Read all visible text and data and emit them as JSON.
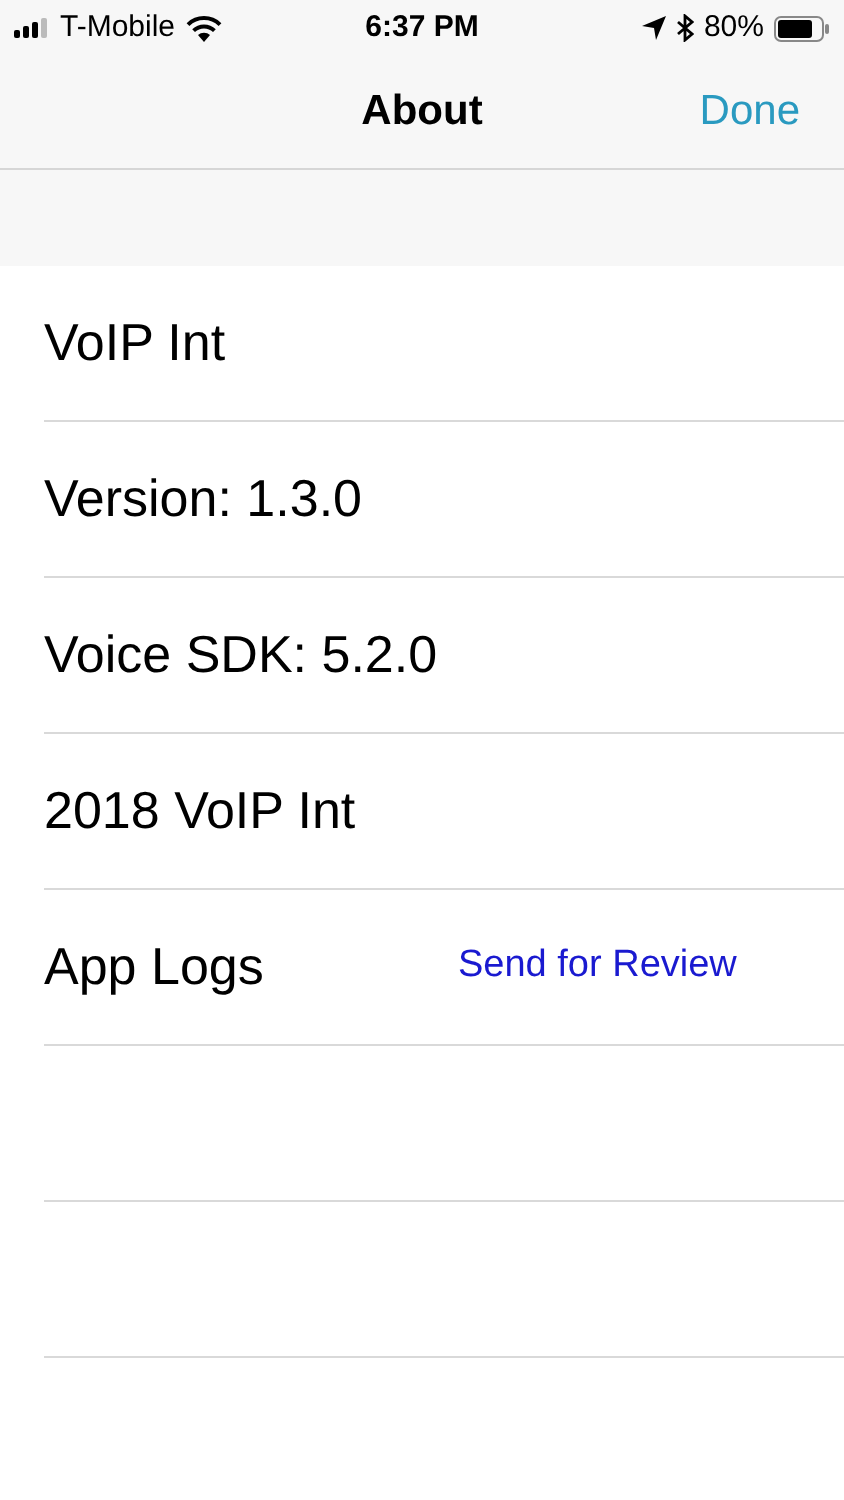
{
  "status_bar": {
    "carrier": "T-Mobile",
    "time": "6:37 PM",
    "battery": "80%"
  },
  "nav_bar": {
    "title": "About",
    "done_button": "Done"
  },
  "rows": [
    {
      "kind": "text",
      "label": "VoIP Int"
    },
    {
      "kind": "text",
      "label": "Version: 1.3.0"
    },
    {
      "kind": "text",
      "label": "Voice SDK: 5.2.0"
    },
    {
      "kind": "text",
      "label": "2018 VoIP Int"
    },
    {
      "kind": "link",
      "label": "App Logs",
      "action": "Send for Review"
    }
  ]
}
